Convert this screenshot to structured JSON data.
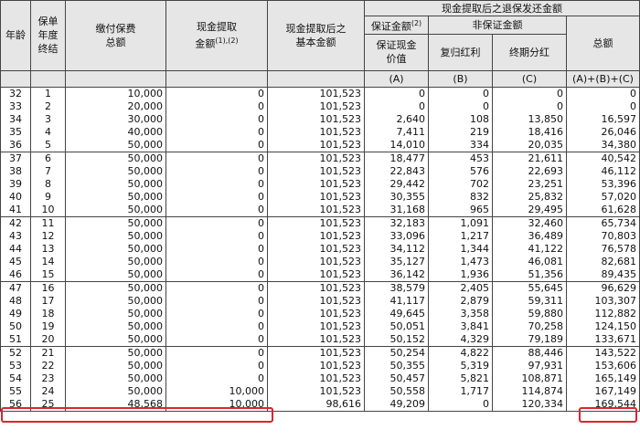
{
  "headers": {
    "age": "年龄",
    "policy_year": "保单\n年度\n终结",
    "total_premium": "缴付保费\n总额",
    "withdrawal": "现金提取\n金额",
    "withdrawal_sup": "(1),(2)",
    "basic_after": "现金提取后之\n基本金额",
    "group": "现金提取后之退保发还金额",
    "guaranteed": "保证金额",
    "guaranteed_sup": "(2)",
    "non_guaranteed": "非保证金额",
    "cash_value": "保证现金\n价值",
    "reversionary_bonus": "复归红利",
    "terminal_dividend": "终期分红",
    "total": "总额",
    "col_a": "(A)",
    "col_b": "(B)",
    "col_c": "(C)",
    "col_sum": "(A)+(B)+(C)"
  },
  "rows": [
    [
      "32",
      "1",
      "10,000",
      "0",
      "101,523",
      "0",
      "0",
      "0",
      "0"
    ],
    [
      "33",
      "2",
      "20,000",
      "0",
      "101,523",
      "0",
      "0",
      "0",
      "0"
    ],
    [
      "34",
      "3",
      "30,000",
      "0",
      "101,523",
      "2,640",
      "108",
      "13,850",
      "16,597"
    ],
    [
      "35",
      "4",
      "40,000",
      "0",
      "101,523",
      "7,411",
      "219",
      "18,416",
      "26,046"
    ],
    [
      "36",
      "5",
      "50,000",
      "0",
      "101,523",
      "14,010",
      "334",
      "20,035",
      "34,380"
    ],
    [
      "37",
      "6",
      "50,000",
      "0",
      "101,523",
      "18,477",
      "453",
      "21,611",
      "40,542"
    ],
    [
      "38",
      "7",
      "50,000",
      "0",
      "101,523",
      "22,843",
      "576",
      "22,693",
      "46,112"
    ],
    [
      "39",
      "8",
      "50,000",
      "0",
      "101,523",
      "29,442",
      "702",
      "23,251",
      "53,396"
    ],
    [
      "40",
      "9",
      "50,000",
      "0",
      "101,523",
      "30,355",
      "832",
      "25,832",
      "57,020"
    ],
    [
      "41",
      "10",
      "50,000",
      "0",
      "101,523",
      "31,168",
      "965",
      "29,495",
      "61,628"
    ],
    [
      "42",
      "11",
      "50,000",
      "0",
      "101,523",
      "32,183",
      "1,091",
      "32,460",
      "65,734"
    ],
    [
      "43",
      "12",
      "50,000",
      "0",
      "101,523",
      "33,096",
      "1,217",
      "36,489",
      "70,803"
    ],
    [
      "44",
      "13",
      "50,000",
      "0",
      "101,523",
      "34,112",
      "1,344",
      "41,122",
      "76,578"
    ],
    [
      "45",
      "14",
      "50,000",
      "0",
      "101,523",
      "35,127",
      "1,473",
      "46,081",
      "82,681"
    ],
    [
      "46",
      "15",
      "50,000",
      "0",
      "101,523",
      "36,142",
      "1,936",
      "51,356",
      "89,435"
    ],
    [
      "47",
      "16",
      "50,000",
      "0",
      "101,523",
      "38,579",
      "2,405",
      "55,645",
      "96,629"
    ],
    [
      "48",
      "17",
      "50,000",
      "0",
      "101,523",
      "41,117",
      "2,879",
      "59,311",
      "103,307"
    ],
    [
      "49",
      "18",
      "50,000",
      "0",
      "101,523",
      "49,645",
      "3,358",
      "59,880",
      "112,882"
    ],
    [
      "50",
      "19",
      "50,000",
      "0",
      "101,523",
      "50,051",
      "3,841",
      "70,258",
      "124,150"
    ],
    [
      "51",
      "20",
      "50,000",
      "0",
      "101,523",
      "50,152",
      "4,329",
      "79,189",
      "133,671"
    ],
    [
      "52",
      "21",
      "50,000",
      "0",
      "101,523",
      "50,254",
      "4,822",
      "88,446",
      "143,522"
    ],
    [
      "53",
      "22",
      "50,000",
      "0",
      "101,523",
      "50,355",
      "5,319",
      "97,931",
      "153,606"
    ],
    [
      "54",
      "23",
      "50,000",
      "0",
      "101,523",
      "50,457",
      "5,821",
      "108,871",
      "165,149"
    ],
    [
      "55",
      "24",
      "50,000",
      "10,000",
      "101,523",
      "50,558",
      "1,717",
      "114,874",
      "167,149"
    ],
    [
      "56",
      "25",
      "48,568",
      "10,000",
      "98,616",
      "49,209",
      "0",
      "120,334",
      "169,544"
    ]
  ],
  "highlights": {
    "row_age": "55",
    "color": "#d9262c"
  }
}
